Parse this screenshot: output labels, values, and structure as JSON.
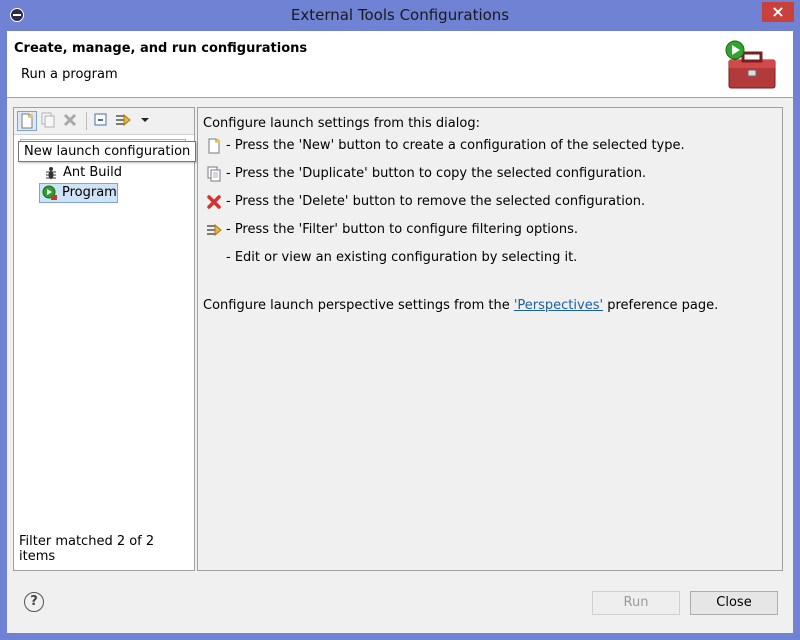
{
  "window": {
    "title": "External Tools Configurations",
    "close_glyph": "×"
  },
  "header": {
    "title": "Create, manage, and run configurations",
    "subtitle": "Run a program"
  },
  "toolbar": {
    "tooltip": "New launch configuration",
    "buttons": [
      "new-launch-config-icon",
      "duplicate-icon",
      "delete-icon",
      "collapse-all-icon",
      "filter-icon",
      "view-menu-icon"
    ]
  },
  "tree": {
    "items": [
      {
        "label": "Ant Build",
        "icon": "ant-icon",
        "selected": false
      },
      {
        "label": "Program",
        "icon": "program-icon",
        "selected": true
      }
    ],
    "status": "Filter matched 2 of 2 items"
  },
  "main": {
    "intro": "Configure launch settings from this dialog:",
    "instructions": [
      {
        "icon": "new-icon",
        "text": "- Press the 'New' button to create a configuration of the selected type."
      },
      {
        "icon": "duplicate-icon",
        "text": "- Press the 'Duplicate' button to copy the selected configuration."
      },
      {
        "icon": "delete-icon",
        "text": "- Press the 'Delete' button to remove the selected configuration."
      },
      {
        "icon": "filter-icon",
        "text": "- Press the 'Filter' button to configure filtering options."
      },
      {
        "icon": "",
        "text": "- Edit or view an existing configuration by selecting it."
      }
    ],
    "perspective_prefix": "Configure launch perspective settings from the ",
    "perspective_link": "'Perspectives'",
    "perspective_suffix": " preference page."
  },
  "footer": {
    "help_glyph": "?",
    "run_label": "Run",
    "close_label": "Close",
    "run_enabled": false
  }
}
